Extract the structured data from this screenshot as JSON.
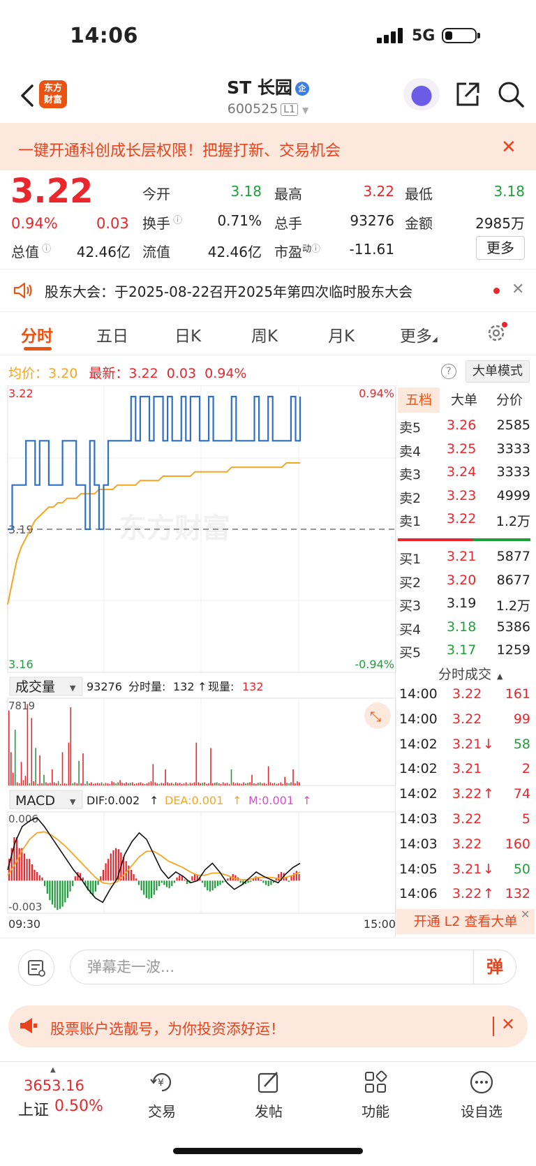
{
  "status": {
    "time": "14:06",
    "network": "5G"
  },
  "header": {
    "logo_line1": "东方",
    "logo_line2": "财富",
    "name": "ST 长园",
    "badge": "企",
    "code": "600525",
    "level": "L1"
  },
  "promo": {
    "text": "一键开通科创成长层权限！把握打新、交易机会",
    "close": "✕"
  },
  "quote": {
    "price": "3.22",
    "change_pct": "0.94%",
    "change": "0.03",
    "open_label": "今开",
    "open": "3.18",
    "high_label": "最高",
    "high": "3.22",
    "low_label": "最低",
    "low": "3.18",
    "turnover_label": "换手",
    "turnover": "0.71%",
    "volume_label": "总手",
    "volume": "93276",
    "amount_label": "金额",
    "amount": "2985万",
    "mcap_label": "总值",
    "mcap": "42.46亿",
    "float_label": "流值",
    "float_cap": "42.46亿",
    "pe_label": "市盈",
    "pe_sup": "动",
    "pe": "-11.61",
    "more": "更多"
  },
  "announcement": {
    "text": "股东大会：于2025-08-22召开2025年第四次临时股东大会",
    "close": "✕"
  },
  "tabs": [
    {
      "label": "分时"
    },
    {
      "label": "五日"
    },
    {
      "label": "日K"
    },
    {
      "label": "周K"
    },
    {
      "label": "月K"
    },
    {
      "label": "更多"
    }
  ],
  "avg_row": {
    "avg_label": "均价：",
    "avg": "3.20",
    "latest_label": "最新：",
    "latest": "3.22",
    "latest_chg": "0.03",
    "latest_pct": "0.94%",
    "help": "?",
    "bigorder_mode": "大单模式"
  },
  "chart_data": [
    {
      "type": "line",
      "series": [],
      "y_top": "3.22",
      "y_mid": "3.19",
      "y_bottom": "3.16",
      "pct_top": "0.94%",
      "pct_bottom": "-0.94%",
      "ylim": [
        3.16,
        3.22
      ],
      "prev_close": 3.19,
      "price": [
        3.19,
        3.2,
        3.2,
        3.2,
        3.21,
        3.21,
        3.2,
        3.21,
        3.21,
        3.2,
        3.2,
        3.2,
        3.21,
        3.21,
        3.21,
        3.2,
        3.2,
        3.19,
        3.21,
        3.2,
        3.19,
        3.2,
        3.21,
        3.21,
        3.21,
        3.21,
        3.21,
        3.22,
        3.21,
        3.22,
        3.22,
        3.21,
        3.22,
        3.22,
        3.21,
        3.22,
        3.21,
        3.21,
        3.22,
        3.21,
        3.22,
        3.22,
        3.21,
        3.21,
        3.22,
        3.21,
        3.21,
        3.21,
        3.21,
        3.22,
        3.21,
        3.21,
        3.21,
        3.21,
        3.22,
        3.21,
        3.21,
        3.22,
        3.21,
        3.21,
        3.21,
        3.21,
        3.22,
        3.21,
        3.22
      ],
      "avg": [
        3.173,
        3.178,
        3.183,
        3.186,
        3.188,
        3.19,
        3.192,
        3.193,
        3.194,
        3.195,
        3.195,
        3.196,
        3.196,
        3.197,
        3.197,
        3.197,
        3.198,
        3.198,
        3.198,
        3.198,
        3.199,
        3.199,
        3.199,
        3.199,
        3.2,
        3.2,
        3.2,
        3.2,
        3.2,
        3.201,
        3.201,
        3.201,
        3.201,
        3.201,
        3.202,
        3.202,
        3.202,
        3.202,
        3.202,
        3.202,
        3.202,
        3.203,
        3.203,
        3.203,
        3.203,
        3.203,
        3.203,
        3.203,
        3.203,
        3.204,
        3.204,
        3.204,
        3.204,
        3.204,
        3.204,
        3.204,
        3.204,
        3.204,
        3.204,
        3.204,
        3.204,
        3.205,
        3.205,
        3.205,
        3.205
      ]
    },
    {
      "type": "bar",
      "series": [],
      "label": "成交量",
      "total": "93276",
      "min_vol_label": "分时量:",
      "min_vol": "132",
      "now_label": "现量:",
      "now_vol": "132",
      "y_max_label": "7819",
      "ylim": [
        0,
        7819
      ],
      "values": [
        7000,
        3100,
        1200,
        5200,
        300,
        200,
        2200,
        500,
        900,
        7600,
        200,
        6300,
        400,
        3500,
        150,
        2800,
        200,
        1000,
        300,
        200,
        250,
        1500,
        300,
        200,
        400,
        150,
        3100,
        200,
        150,
        4000,
        7300,
        200,
        300,
        200,
        2300,
        200,
        3000,
        150,
        400,
        200,
        300,
        150,
        200,
        250,
        200,
        300,
        150,
        250,
        200,
        150,
        400,
        300,
        200,
        300,
        500,
        250,
        200,
        300,
        200,
        250,
        300,
        150,
        200,
        250,
        300,
        200,
        150,
        200,
        300,
        400,
        2000,
        300,
        200,
        150,
        250,
        200,
        1500,
        300,
        200,
        250,
        150,
        300,
        200,
        250,
        150,
        200,
        300,
        150,
        250,
        200,
        300,
        4000,
        300,
        200,
        250,
        300,
        150,
        200,
        3500,
        200,
        250,
        300,
        200,
        150,
        300,
        200,
        250,
        150,
        1500,
        300,
        200,
        250,
        200,
        150,
        300,
        200,
        250,
        300,
        1000,
        200,
        150,
        250,
        300,
        200,
        250,
        150,
        1800,
        300,
        200,
        250,
        150,
        200,
        300,
        150,
        800,
        250,
        200,
        300,
        1500,
        200,
        400,
        300
      ],
      "colors_up": "#e8262c",
      "colors_down": "#1e9e3a"
    },
    {
      "type": "bar",
      "series": [],
      "label": "MACD",
      "dif_label": "DIF:0.002",
      "dea_label": "DEA:0.001",
      "m_label": "M:0.001",
      "y_top": "0.006",
      "y_bottom": "-0.003",
      "ylim": [
        -0.003,
        0.006
      ],
      "x_start": "09:30",
      "x_end": "15:00",
      "hist": [
        0.002,
        0.003,
        0.004,
        0.004,
        0.003,
        0.003,
        0.0025,
        0.002,
        0.002,
        0.0015,
        0.001,
        0.0008,
        0.0005,
        0.0003,
        -0.0005,
        -0.0012,
        -0.0018,
        -0.0022,
        -0.0025,
        -0.0027,
        -0.0026,
        -0.0024,
        -0.002,
        -0.0016,
        -0.001,
        -0.0005,
        0.0004,
        0.0008,
        0.0007,
        0.0003,
        -0.0004,
        -0.0009,
        -0.0012,
        -0.0014,
        -0.001,
        -0.0004,
        0.0004,
        0.001,
        0.0016,
        0.002,
        0.0025,
        0.0028,
        0.003,
        0.0029,
        0.0026,
        0.0022,
        0.0018,
        0.0014,
        0.001,
        0.0006,
        0.0002,
        -0.0004,
        -0.0009,
        -0.0013,
        -0.0016,
        -0.0017,
        -0.0016,
        -0.0013,
        -0.0009,
        -0.0005,
        -0.0002,
        -0.0004,
        -0.0006,
        -0.0007,
        -0.0005,
        -0.0002,
        0.0003,
        0.0005,
        0.0004,
        0.0001,
        -0.0003,
        -0.0002,
        0.0004,
        0.0006,
        0.0005,
        0.0003,
        -0.0002,
        -0.0006,
        -0.0009,
        -0.001,
        -0.0009,
        -0.0007,
        -0.0005,
        -0.0004,
        -0.0002,
        -0.0001,
        0.0002,
        0.0004,
        0.0006,
        0.0005,
        0.0003,
        -0.0002,
        -0.0004,
        -0.0003,
        -0.0002,
        -0.0001,
        0.0002,
        0.0004,
        0.0003,
        0.0001,
        -0.0002,
        -0.0004,
        -0.0005,
        -0.0004,
        -0.0002,
        0.0002,
        0.0006,
        0.0008,
        0.0007,
        0.0003,
        -0.0001,
        0.0004,
        0.0007,
        0.0009,
        0.0006
      ],
      "dif": [
        0.001,
        0.0035,
        0.005,
        0.0055,
        0.0058,
        0.005,
        0.004,
        0.003,
        0.002,
        0.001,
        0.0002,
        -0.0008,
        -0.0016,
        -0.002,
        -0.0008,
        0.0002,
        0.0024,
        0.0036,
        0.0044,
        0.0038,
        0.0024,
        0.001,
        0.0002,
        0.0008,
        0.0004,
        -0.0002,
        0.0,
        0.001,
        0.0016,
        0.0008,
        -0.0002,
        -0.0008,
        -0.0004,
        0.0002,
        0.0008,
        0.0004,
        0.0001,
        -0.0002,
        0.0006,
        0.0012,
        0.0016
      ],
      "dea": [
        0.0005,
        0.0015,
        0.0028,
        0.0038,
        0.0044,
        0.0045,
        0.0042,
        0.0037,
        0.0031,
        0.0024,
        0.0017,
        0.001,
        0.0003,
        -0.0002,
        -0.0003,
        -0.0001,
        0.0006,
        0.0014,
        0.0022,
        0.0027,
        0.0027,
        0.0023,
        0.0018,
        0.0015,
        0.0012,
        0.0008,
        0.0005,
        0.0005,
        0.0007,
        0.0007,
        0.0005,
        0.0002,
        0.0001,
        0.0001,
        0.0003,
        0.0003,
        0.0003,
        0.0002,
        0.0003,
        0.0005,
        0.0008
      ]
    }
  ],
  "orderbook": {
    "tabs": [
      "五档",
      "大单",
      "分价"
    ],
    "asks": [
      {
        "label": "卖5",
        "price": "3.26",
        "vol": "2585"
      },
      {
        "label": "卖4",
        "price": "3.25",
        "vol": "3333"
      },
      {
        "label": "卖3",
        "price": "3.24",
        "vol": "3333"
      },
      {
        "label": "卖2",
        "price": "3.23",
        "vol": "4999"
      },
      {
        "label": "卖1",
        "price": "3.22",
        "vol": "1.2万"
      }
    ],
    "bids": [
      {
        "label": "买1",
        "price": "3.21",
        "vol": "5877"
      },
      {
        "label": "买2",
        "price": "3.20",
        "vol": "8677"
      },
      {
        "label": "买3",
        "price": "3.19",
        "vol": "1.2万"
      },
      {
        "label": "买4",
        "price": "3.18",
        "vol": "5386"
      },
      {
        "label": "买5",
        "price": "3.17",
        "vol": "1259"
      }
    ]
  },
  "trades": {
    "header": "分时成交",
    "rows": [
      {
        "time": "14:00",
        "price": "3.22",
        "vol": "161",
        "arrow": ""
      },
      {
        "time": "14:00",
        "price": "3.22",
        "vol": "99",
        "arrow": ""
      },
      {
        "time": "14:02",
        "price": "3.21",
        "vol": "58",
        "arrow": "↓"
      },
      {
        "time": "14:02",
        "price": "3.21",
        "vol": "2",
        "arrow": ""
      },
      {
        "time": "14:02",
        "price": "3.22",
        "vol": "74",
        "arrow": "↑"
      },
      {
        "time": "14:03",
        "price": "3.22",
        "vol": "5",
        "arrow": ""
      },
      {
        "time": "14:03",
        "price": "3.22",
        "vol": "160",
        "arrow": ""
      },
      {
        "time": "14:05",
        "price": "3.21",
        "vol": "50",
        "arrow": "↓"
      },
      {
        "time": "14:06",
        "price": "3.22",
        "vol": "132",
        "arrow": "↑"
      }
    ],
    "l2_button": "开通 L2 查看大单"
  },
  "watermark": "东方财富",
  "comment": {
    "placeholder": "弹幕走一波...",
    "danmu_btn": "弹"
  },
  "ad": {
    "text": "股票账户选靓号，为你投资添好运！",
    "close": "✕"
  },
  "bottom_nav": {
    "index_value": "3653.16",
    "index_name": "上证",
    "index_change": "0.50%",
    "items": [
      {
        "label": "交易"
      },
      {
        "label": "发帖"
      },
      {
        "label": "功能"
      },
      {
        "label": "设自选"
      }
    ]
  },
  "colors": {
    "up": "#e8262c",
    "down": "#1e9e3a",
    "price_line": "#2f6fc4",
    "avg_line": "#f5a623",
    "accent": "#ea5413"
  }
}
